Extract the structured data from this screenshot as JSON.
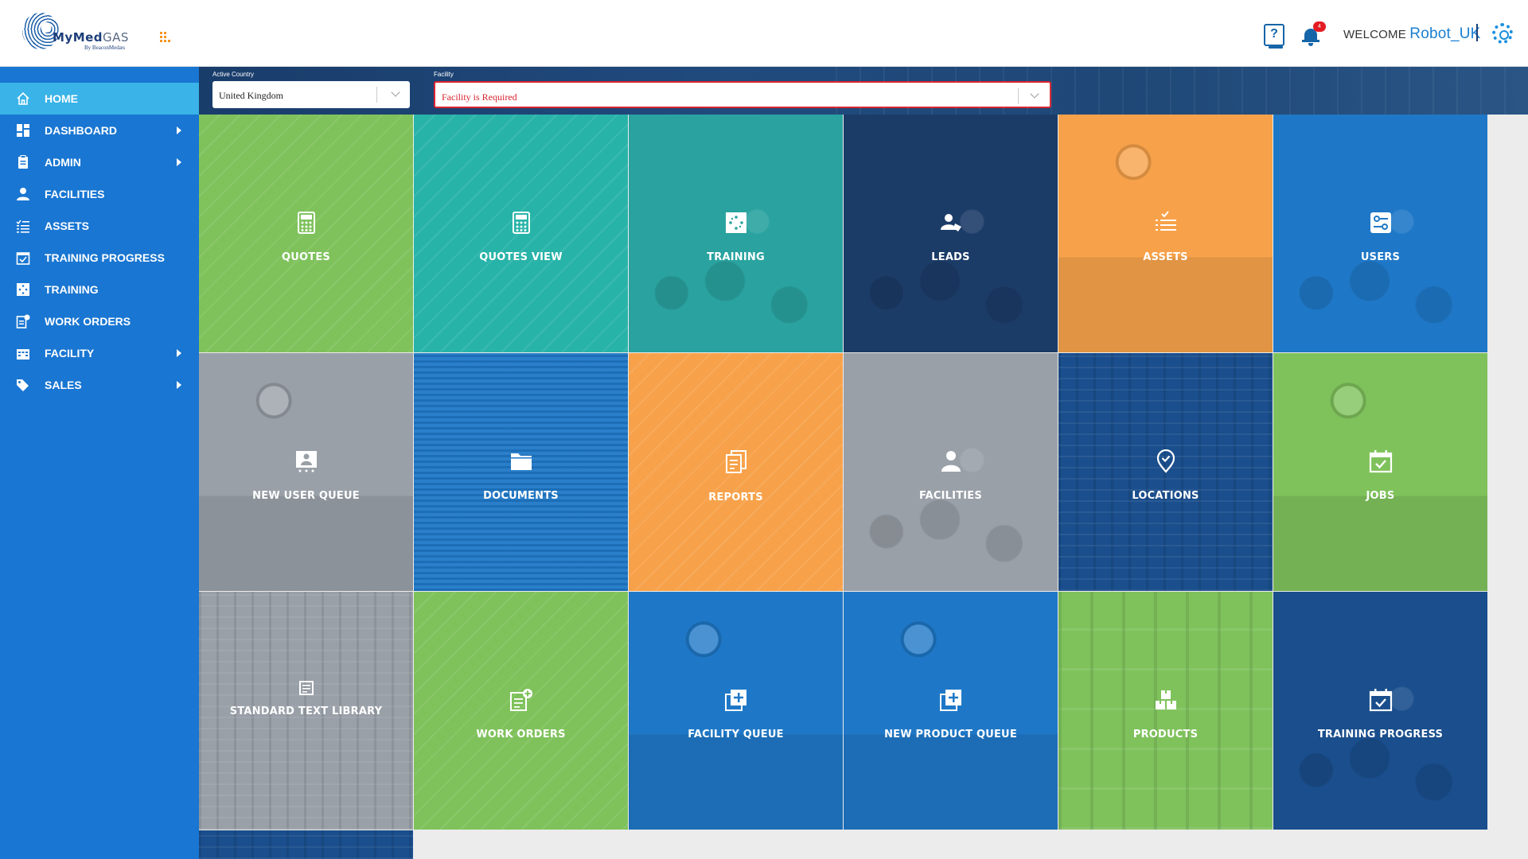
{
  "header": {
    "logo_text_primary": "MyMed",
    "logo_text_secondary": "GAS",
    "logo_subtext": "By BeaconMedæs",
    "help_icon": "help-book-icon",
    "notification_icon": "bell-icon",
    "notification_count": "4",
    "welcome_label": "WELCOME",
    "username": "Robot_UK",
    "settings_icon": "gear-icon"
  },
  "sidebar": {
    "items": [
      {
        "label": "HOME",
        "icon": "home-icon",
        "active": true,
        "submenu": false
      },
      {
        "label": "DASHBOARD",
        "icon": "dashboard-icon",
        "active": false,
        "submenu": true
      },
      {
        "label": "ADMIN",
        "icon": "clipboard-icon",
        "active": false,
        "submenu": true
      },
      {
        "label": "FACILITIES",
        "icon": "person-icon",
        "active": false,
        "submenu": false
      },
      {
        "label": "ASSETS",
        "icon": "checklist-icon",
        "active": false,
        "submenu": false
      },
      {
        "label": "TRAINING PROGRESS",
        "icon": "calendar-check-icon",
        "active": false,
        "submenu": false
      },
      {
        "label": "TRAINING",
        "icon": "training-icon",
        "active": false,
        "submenu": false
      },
      {
        "label": "WORK ORDERS",
        "icon": "work-order-icon",
        "active": false,
        "submenu": false
      },
      {
        "label": "FACILITY",
        "icon": "building-icon",
        "active": false,
        "submenu": true
      },
      {
        "label": "SALES",
        "icon": "tags-icon",
        "active": false,
        "submenu": true
      }
    ]
  },
  "filters": {
    "country_label": "Active Country",
    "country_value": "United Kingdom",
    "facility_label": "Facility",
    "facility_value": "Facility is Required"
  },
  "tiles": [
    {
      "label": "QUOTES",
      "icon": "calculator-icon",
      "color": "#7fc25c"
    },
    {
      "label": "QUOTES VIEW",
      "icon": "calculator-icon",
      "color": "#28b3a9"
    },
    {
      "label": "TRAINING",
      "icon": "training-icon",
      "color": "#2aa3a0"
    },
    {
      "label": "LEADS",
      "icon": "lead-icon",
      "color": "#1c3c68"
    },
    {
      "label": "ASSETS",
      "icon": "checklist-icon",
      "color": "#f7a24a"
    },
    {
      "label": "USERS",
      "icon": "user-settings-icon",
      "color": "#1f78c7"
    },
    {
      "label": "NEW USER QUEUE",
      "icon": "user-card-icon",
      "color": "#9aa0a8"
    },
    {
      "label": "DOCUMENTS",
      "icon": "folder-icon",
      "color": "#1f78c7"
    },
    {
      "label": "REPORTS",
      "icon": "reports-icon",
      "color": "#f7a24a"
    },
    {
      "label": "FACILITIES",
      "icon": "person-icon",
      "color": "#9aa0a8"
    },
    {
      "label": "LOCATIONS",
      "icon": "location-pin-icon",
      "color": "#1a4e8c"
    },
    {
      "label": "JOBS",
      "icon": "calendar-check-icon",
      "color": "#7fc25c"
    },
    {
      "label": "STANDARD TEXT LIBRARY",
      "icon": "document-icon",
      "color": "#9aa0a8"
    },
    {
      "label": "WORK ORDERS",
      "icon": "work-order-icon",
      "color": "#7fc25c"
    },
    {
      "label": "FACILITY QUEUE",
      "icon": "add-queue-icon",
      "color": "#1f78c7"
    },
    {
      "label": "NEW PRODUCT QUEUE",
      "icon": "add-queue-icon",
      "color": "#1f78c7"
    },
    {
      "label": "PRODUCTS",
      "icon": "boxes-icon",
      "color": "#7fc25c"
    },
    {
      "label": "TRAINING PROGRESS",
      "icon": "calendar-check-icon",
      "color": "#1a4e8c"
    }
  ],
  "colors": {
    "sidebar": "#1976d2",
    "sidebar_active": "#39b3e8",
    "error": "#d9242e",
    "accent": "#1a7fd0"
  }
}
